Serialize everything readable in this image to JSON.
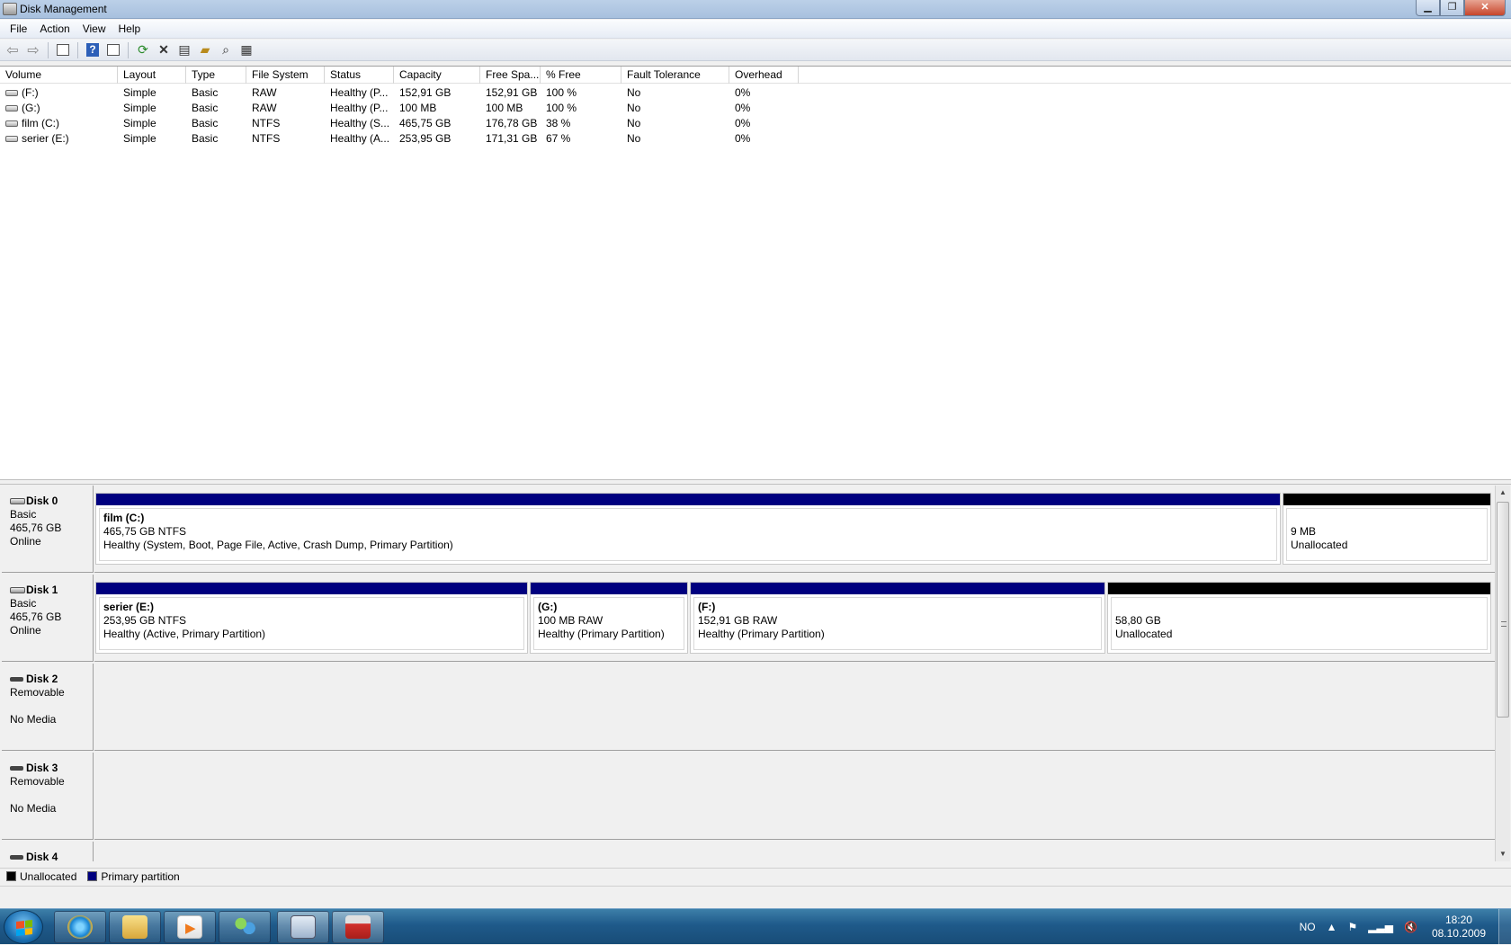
{
  "window": {
    "title": "Disk Management",
    "min_glyph": "▁",
    "restore_glyph": "❐",
    "close_glyph": "✕"
  },
  "menu": [
    "File",
    "Action",
    "View",
    "Help"
  ],
  "toolbar": {
    "icons": [
      "back-icon",
      "forward-icon",
      "console-tree-icon",
      "help-icon",
      "detail-pane-icon",
      "refresh-icon",
      "delete-icon",
      "properties-icon",
      "open-icon",
      "search-icon",
      "rescan-icon"
    ]
  },
  "volume_list": {
    "columns": [
      "Volume",
      "Layout",
      "Type",
      "File System",
      "Status",
      "Capacity",
      "Free Spa...",
      "% Free",
      "Fault Tolerance",
      "Overhead"
    ],
    "rows": [
      [
        "(F:)",
        "Simple",
        "Basic",
        "RAW",
        "Healthy (P...",
        "152,91 GB",
        "152,91 GB",
        "100 %",
        "No",
        "0%"
      ],
      [
        "(G:)",
        "Simple",
        "Basic",
        "RAW",
        "Healthy (P...",
        "100 MB",
        "100 MB",
        "100 %",
        "No",
        "0%"
      ],
      [
        "film (C:)",
        "Simple",
        "Basic",
        "NTFS",
        "Healthy (S...",
        "465,75 GB",
        "176,78 GB",
        "38 %",
        "No",
        "0%"
      ],
      [
        "serier (E:)",
        "Simple",
        "Basic",
        "NTFS",
        "Healthy (A...",
        "253,95 GB",
        "171,31 GB",
        "67 %",
        "No",
        "0%"
      ]
    ]
  },
  "disks": [
    {
      "name": "Disk 0",
      "type": "Basic",
      "size": "465,76 GB",
      "state": "Online",
      "partitions": [
        {
          "kind": "primary",
          "name": "film  (C:)",
          "size": "465,75 GB NTFS",
          "status": "Healthy (System, Boot, Page File, Active, Crash Dump, Primary Partition)"
        },
        {
          "kind": "unallocated",
          "name": "",
          "size": "9 MB",
          "status": "Unallocated"
        }
      ]
    },
    {
      "name": "Disk 1",
      "type": "Basic",
      "size": "465,76 GB",
      "state": "Online",
      "partitions": [
        {
          "kind": "primary",
          "name": "serier  (E:)",
          "size": "253,95 GB NTFS",
          "status": "Healthy (Active, Primary Partition)"
        },
        {
          "kind": "primary",
          "name": "(G:)",
          "size": "100 MB RAW",
          "status": "Healthy (Primary Partition)"
        },
        {
          "kind": "primary",
          "name": "(F:)",
          "size": "152,91 GB RAW",
          "status": "Healthy (Primary Partition)"
        },
        {
          "kind": "unallocated",
          "name": "",
          "size": "58,80 GB",
          "status": "Unallocated"
        }
      ]
    },
    {
      "name": "Disk 2",
      "type": "Removable",
      "size": "",
      "state": "No Media"
    },
    {
      "name": "Disk 3",
      "type": "Removable",
      "size": "",
      "state": "No Media"
    },
    {
      "name": "Disk 4",
      "type": "",
      "size": "",
      "state": ""
    }
  ],
  "legend": [
    {
      "label": "Unallocated",
      "color": "#000000"
    },
    {
      "label": "Primary partition",
      "color": "#00007f"
    }
  ],
  "taskbar": {
    "apps": [
      "internet-explorer-icon",
      "explorer-folder-icon",
      "media-player-icon",
      "messenger-icon",
      "remote-desktop-icon",
      "disk-management-toolbox-icon"
    ],
    "language": "NO",
    "time": "18:20",
    "date": "08.10.2009"
  },
  "colors": {
    "primary_partition": "#00007f",
    "unallocated": "#000000"
  }
}
